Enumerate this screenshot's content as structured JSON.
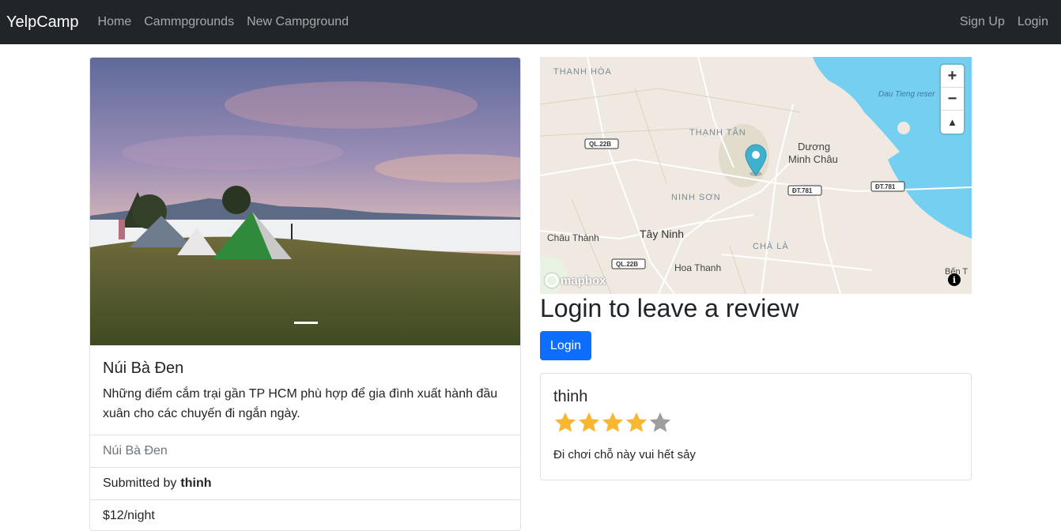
{
  "navbar": {
    "brand": "YelpCamp",
    "links": [
      "Home",
      "Cammpgrounds",
      "New Campground"
    ],
    "right_links": [
      "Sign Up",
      "Login"
    ]
  },
  "campground": {
    "title": "Núi Bà Đen",
    "description": "Những điểm cắm trại gần TP HCM phù hợp để gia đình xuất hành đầu xuân cho các chuyến đi ngắn ngày.",
    "location": "Núi Bà Đen",
    "submitted_prefix": "Submitted by",
    "author": "thinh",
    "price": "$12/night"
  },
  "map": {
    "labels": {
      "thanh_hoa": "THANH HÒA",
      "thanh_tan": "THẠNH TÂN",
      "duong": "Dương",
      "minh_chau": "Minh Châu",
      "ninh_son": "NINH SƠN",
      "chau_thanh": "Châu Thành",
      "tay_ninh": "Tây Ninh",
      "cha_la": "CHÀ LÀ",
      "hoa_thanh": "Hoa Thanh",
      "dau_tieng": "Dau Tieng reser",
      "ben_t": "Bến T",
      "ql22b_1": "QL.22B",
      "ql22b_2": "QL.22B",
      "dt781_1": "ĐT.781",
      "dt781_2": "ĐT.781"
    },
    "zoom_in": "+",
    "zoom_out": "−",
    "compass": "▲",
    "logo": "mapbox",
    "info": "i"
  },
  "review_section": {
    "heading": "Login to leave a review",
    "login_button": "Login"
  },
  "review": {
    "author": "thinh",
    "rating": 4,
    "max_rating": 5,
    "text": "Đi chơi chỗ này vui hết sảy"
  },
  "colors": {
    "primary": "#0d6efd",
    "navbar": "#212529",
    "star_on": "#f7b731",
    "star_off": "#9e9e9e",
    "water": "#75cff0"
  }
}
